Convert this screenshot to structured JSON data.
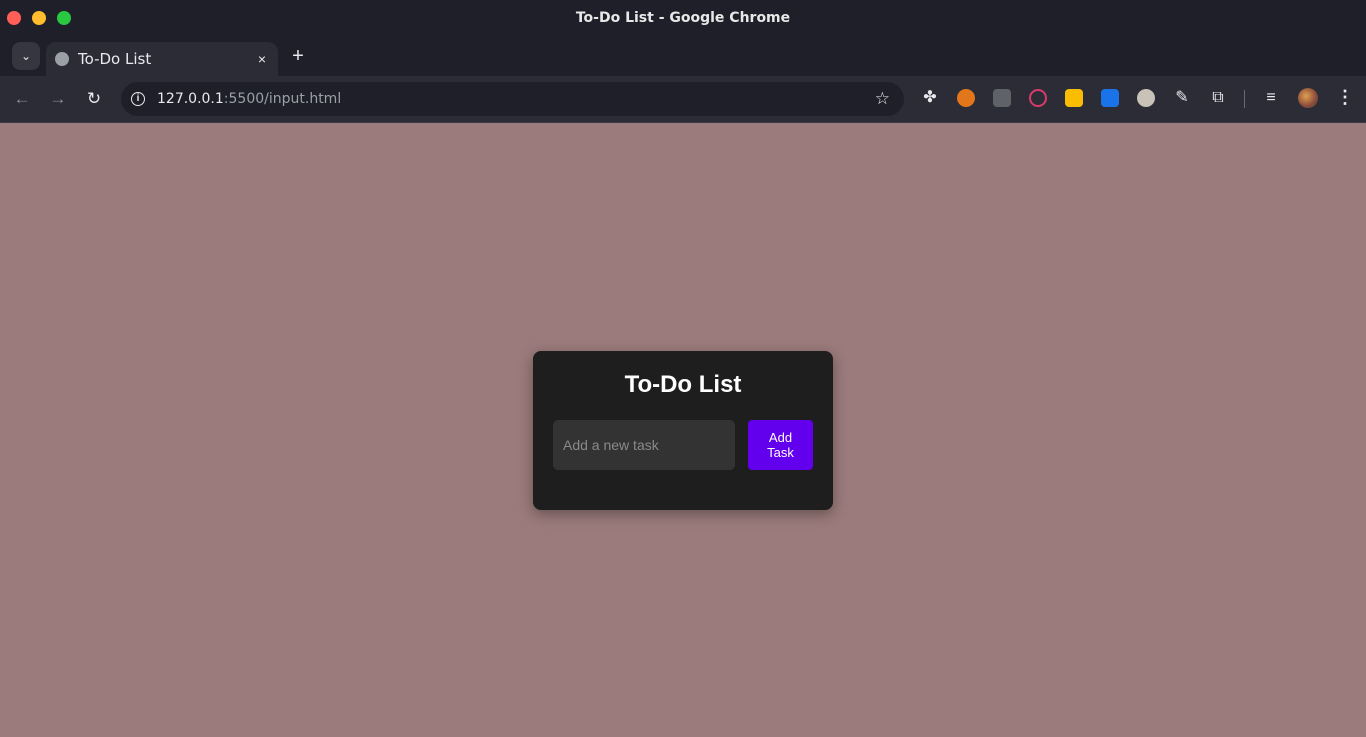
{
  "window": {
    "title": "To-Do List - Google Chrome"
  },
  "tab": {
    "title": "To-Do List",
    "close_glyph": "×",
    "new_tab_glyph": "+"
  },
  "toolbar": {
    "url_host": "127.0.0.1",
    "url_path": ":5500/input.html",
    "extensions": [
      "gnome-icon",
      "metamask-icon",
      "robot-icon",
      "media-play-icon",
      "keep-icon",
      "trello-icon",
      "face-icon",
      "eyedropper-icon",
      "puzzle-icon",
      "media-queue-icon"
    ]
  },
  "page": {
    "background": "#9b7b7b",
    "card_title": "To-Do List",
    "input_placeholder": "Add a new task",
    "input_value": "",
    "add_button_label": "Add Task",
    "accent": "#6200ee"
  }
}
